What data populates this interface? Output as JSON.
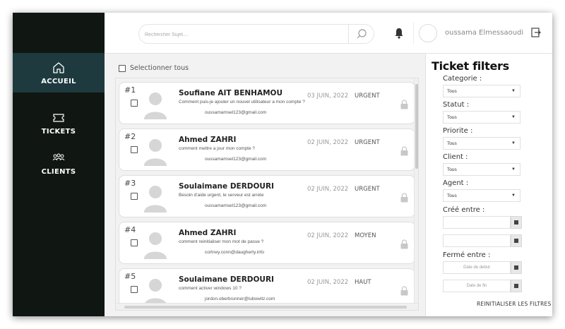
{
  "sidebar": {
    "items": [
      {
        "label": "ACCUEIL",
        "icon": "home-icon",
        "active": true
      },
      {
        "label": "TICKETS",
        "icon": "ticket-icon",
        "active": false
      },
      {
        "label": "CLIENTS",
        "icon": "users-icon",
        "active": false
      }
    ]
  },
  "topbar": {
    "search_placeholder": "Rechercher Sujet....",
    "user_name": "oussama Elmessaoudi"
  },
  "list": {
    "select_all_label": "Selectionner tous",
    "tickets": [
      {
        "num": "#1",
        "name": "Soufiane AIT BENHAMOU",
        "desc": "Comment puis-je ajouter un nouvel utilisateur a mon compte ?",
        "email": "oussamamsel123@gmail.com",
        "date": "03 JUIN, 2022",
        "priority": "URGENT"
      },
      {
        "num": "#2",
        "name": "Ahmed ZAHRI",
        "desc": "comment mettre a jour mon compte ?",
        "email": "oussamamsel123@gmail.com",
        "date": "02 JUIN, 2022",
        "priority": "URGENT"
      },
      {
        "num": "#3",
        "name": "Soulaimane DERDOURI",
        "desc": "Besoin d'aide urgent, le serveur est arrete",
        "email": "oussamamsel123@gmail.com",
        "date": "02 JUIN, 2022",
        "priority": "URGENT"
      },
      {
        "num": "#4",
        "name": "Ahmed ZAHRI",
        "desc": "comment reinitialiser mon mot de passe ?",
        "email": "cortney.conn@daugherty.info",
        "date": "02 JUIN, 2022",
        "priority": "MOYEN"
      },
      {
        "num": "#5",
        "name": "Soulaimane DERDOURI",
        "desc": "comment activer windows 10 ?",
        "email": "jordon.oberbrunner@lubowitz.com",
        "date": "02 JUIN, 2022",
        "priority": "HAUT"
      }
    ]
  },
  "filters": {
    "title": "Ticket filters",
    "categorie_label": "Categorie :",
    "categorie_value": "Tous",
    "statut_label": "Statut :",
    "statut_value": "Tous",
    "priorite_label": "Priorite :",
    "priorite_value": "Tous",
    "client_label": "Client :",
    "client_value": "Tous",
    "agent_label": "Agent :",
    "agent_value": "Tous",
    "cree_label": "Créé entre :",
    "ferme_label": "Fermé entre :",
    "date_debut_placeholder": "Date de debut",
    "date_fin_placeholder": "Date de fin",
    "reset_label": "REINITIALISER LES FILTRES"
  },
  "colors": {
    "sidebar_bg": "#101612",
    "sidebar_active": "#1e3a3f",
    "main_bg": "#f2f2f2"
  }
}
